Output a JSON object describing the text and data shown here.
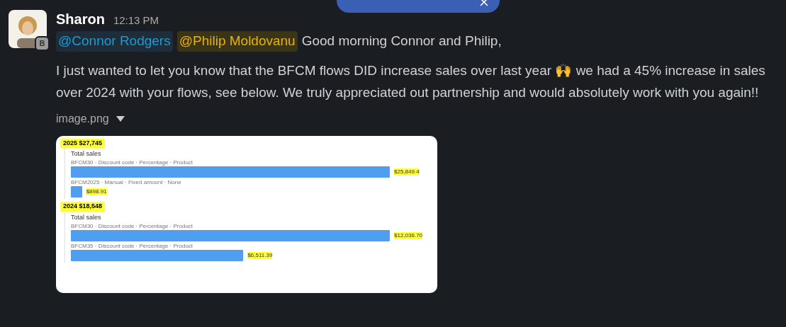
{
  "message": {
    "author": "Sharon",
    "time": "12:13 PM",
    "badge": "B",
    "mentions": [
      {
        "name": "@Connor Rodgers",
        "self": false
      },
      {
        "name": "@Philip Moldovanu",
        "self": true
      }
    ],
    "greeting": "Good morning Connor and Philip,",
    "body": "I just wanted to let you know that the BFCM flows DID increase sales over last year 🙌  we had a 45% increase in sales over 2024 with your flows, see below. We truly appreciated out partnership and would absolutely work with you again!!",
    "attachment": {
      "filename": "image.png",
      "sections": [
        {
          "heading": "2025 $27,745",
          "title": "Total sales",
          "bars": [
            {
              "label": "BFCM30 · Discount code · Percentage · Product",
              "value": "$25,849.4"
            },
            {
              "label": "BFCM2025 · Manual · Fixed amount · None",
              "value": "$898.91"
            }
          ]
        },
        {
          "heading": "2024 $18,548",
          "title": "Total sales",
          "bars": [
            {
              "label": "BFCM30 · Discount code · Percentage · Product",
              "value": "$12,036.70"
            },
            {
              "label": "BFCM35 · Discount code · Percentage · Product",
              "value": "$6,511.39"
            }
          ]
        }
      ]
    }
  }
}
